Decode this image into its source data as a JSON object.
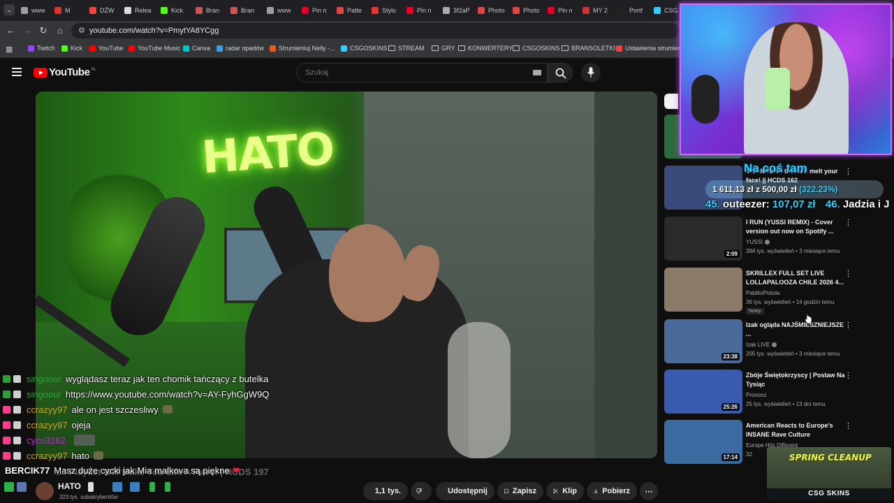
{
  "browser": {
    "tabs": [
      {
        "label": "www",
        "color": "#9aa0a6"
      },
      {
        "label": "M",
        "color": "#d33"
      },
      {
        "label": "DŹW",
        "color": "#e44"
      },
      {
        "label": "Relea",
        "color": "#ddd"
      },
      {
        "label": "Kick",
        "color": "#53fc18"
      },
      {
        "label": "Bran",
        "color": "#c55"
      },
      {
        "label": "Bran",
        "color": "#c55"
      },
      {
        "label": "www",
        "color": "#9aa0a6"
      },
      {
        "label": "Pin n",
        "color": "#e60023"
      },
      {
        "label": "Patte",
        "color": "#d44"
      },
      {
        "label": "Stylo",
        "color": "#e33"
      },
      {
        "label": "Pin n",
        "color": "#e60023"
      },
      {
        "label": "3f2aP",
        "color": "#aaa"
      },
      {
        "label": "Photo",
        "color": "#d44"
      },
      {
        "label": "Photo",
        "color": "#d44"
      },
      {
        "label": "Pin n",
        "color": "#e60023"
      },
      {
        "label": "MY 2",
        "color": "#c33"
      },
      {
        "label": "Portf",
        "color": "#222"
      },
      {
        "label": "CSG",
        "color": "#3cf"
      }
    ],
    "url": "youtube.com/watch?v=PmytYA8YCgg",
    "bookmarks": [
      {
        "label": "Twitch",
        "icon": "twitch-icon",
        "color": "#9146ff"
      },
      {
        "label": "Kick",
        "icon": "kick-icon",
        "color": "#53fc18"
      },
      {
        "label": "YouTube",
        "icon": "youtube-icon",
        "color": "#ff0000"
      },
      {
        "label": "YouTube Music",
        "icon": "youtube-music-icon",
        "color": "#ff0000"
      },
      {
        "label": "Canva",
        "icon": "canva-icon",
        "color": "#00c4cc"
      },
      {
        "label": "radar opadów",
        "icon": "radar-icon",
        "color": "#3aa0e0"
      },
      {
        "label": "Strumieniuj Nelly -...",
        "icon": "stream-icon",
        "color": "#e85c20"
      },
      {
        "label": "CSGOSKINS",
        "icon": "csgoskins-icon",
        "color": "#3cf"
      },
      {
        "label": "STREAM",
        "icon": "folder-icon"
      },
      {
        "label": "GRY",
        "icon": "folder-icon"
      },
      {
        "label": "KONWERTERY",
        "icon": "folder-icon"
      },
      {
        "label": "CSGOSKINS",
        "icon": "folder-icon"
      },
      {
        "label": "BRANSOLETKI",
        "icon": "folder-icon"
      },
      {
        "label": "Ustawienia strumien...",
        "icon": "settings-site-icon",
        "color": "#e44"
      }
    ]
  },
  "youtube": {
    "logo_text": "YouTube",
    "country": "PL",
    "search_placeholder": "Szukaj"
  },
  "video": {
    "neon_sign": "HATO",
    "channel_name": "HATO",
    "subscribers": "323 tys. subskrybentów",
    "title_overlay": "...! Playlist Will Make You Life A Rave! | HCDS 197",
    "actions": {
      "like": "1,1 tys.",
      "share": "Udostępnij",
      "save": "Zapisz",
      "clip": "Klip",
      "download": "Pobierz"
    }
  },
  "chat": [
    {
      "user": "singoour",
      "color": "#2e9e3a",
      "message": "wyglądasz teraz jak ten chomik tańczący z butelka",
      "badge": "#2e9e3a"
    },
    {
      "user": "singoour",
      "color": "#2e9e3a",
      "message": "https://www.youtube.com/watch?v=AY-FyhGgW9Q",
      "badge": "#2e9e3a"
    },
    {
      "user": "ccrazyy97",
      "color": "#c9a227",
      "message": "ale on jest szczesliwy",
      "badge": "#ff3d8a",
      "emote": true
    },
    {
      "user": "ccrazyy97",
      "color": "#c9a227",
      "message": "ojeja",
      "badge": "#ff3d8a"
    },
    {
      "user": "cycu3162",
      "color": "#c026d3",
      "message": "",
      "badge": "#ff3d8a",
      "emote_big": true
    },
    {
      "user": "ccrazyy97",
      "color": "#c9a227",
      "message": "hato",
      "badge": "#ff3d8a",
      "emote": true
    }
  ],
  "chat_latest": {
    "user": "BERCIK77",
    "message": "Masz duże cycki jak Mia malkova są piękne"
  },
  "sidebar": [
    {
      "title": "I RUN (YUSSI REMIX) - Cover version out now on Spotify ...",
      "channel": "YUSSI",
      "verified": true,
      "meta": "394 tys. wyświetleń • 3 miesiące temu",
      "duration": "2:09",
      "thumb": "#2a2a2a"
    },
    {
      "title": "SKRILLEX FULL SET LIVE LOLLAPALOOZA CHILE 2026 4...",
      "channel": "PablitoPistola",
      "meta": "36 tys. wyświetleń • 14 godzin temu",
      "badge": "Nowy",
      "thumb": "#8a7a6a"
    },
    {
      "title": "Izak ogląda NAJŚMIESZNIEJSZE ...",
      "channel": "Izak LIVE",
      "verified": true,
      "meta": "205 tys. wyświetleń • 3 miesiące temu",
      "duration": "23:38",
      "thumb": "#4a6a9a"
    },
    {
      "title": "Zbóje Świętokrzyscy | Postaw Na Tysiąc",
      "channel": "Pronosz",
      "meta": "25 tys. wyświetleń • 13 dni temu",
      "duration": "25:26",
      "thumb": "#3a5ab0"
    },
    {
      "title": "American Reacts to Europe's INSANE Rave Culture",
      "channel": "Europe Hits Different",
      "meta": "32",
      "duration": "17:14",
      "thumb": "#3a6aa0"
    }
  ],
  "sidebar_partial": {
    "title": "1 BANGERS that will melt your face! || HCDS 162"
  },
  "overlay": {
    "tip_title": "Na coś tam",
    "current": "1 611,13 zł",
    "separator": "z",
    "goal": "500,00 zł",
    "percent": "(322.23%)",
    "leader1_num": "45.",
    "leader1_name": "outeezer:",
    "leader1_amount": "107,07 zł",
    "leader2_num": "46.",
    "leader2_name": "Jadzia i J",
    "sponsor_title": "SPRING CLEANUP",
    "sponsor_brand": "CSG SKINS"
  }
}
